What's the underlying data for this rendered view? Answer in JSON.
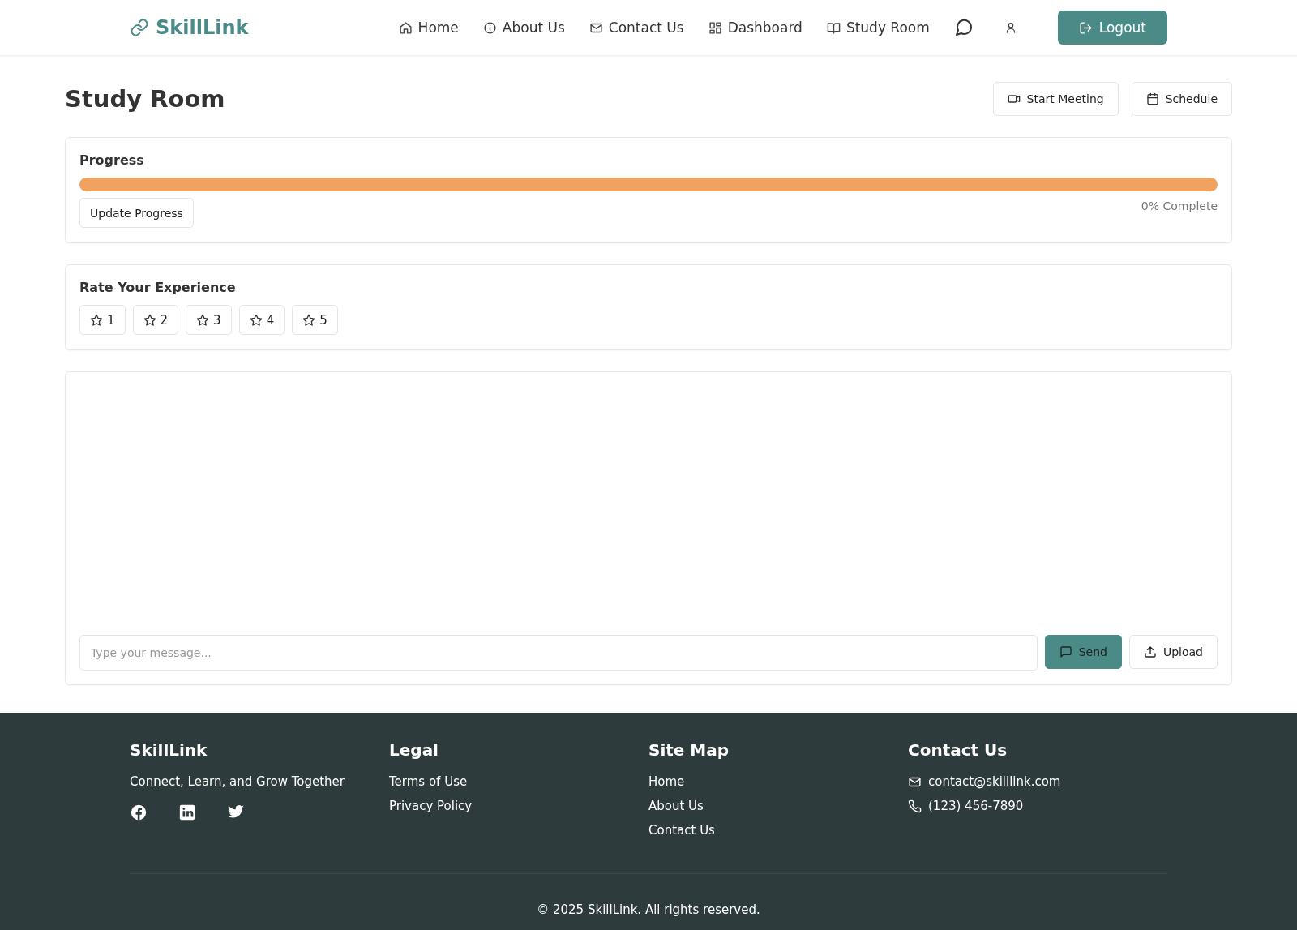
{
  "nav": {
    "brand": "SkillLink",
    "links": [
      {
        "label": "Home",
        "kind": "home"
      },
      {
        "label": "About Us",
        "kind": "info"
      },
      {
        "label": "Contact Us",
        "kind": "mail"
      },
      {
        "label": "Dashboard",
        "kind": "grid"
      },
      {
        "label": "Study Room",
        "kind": "book"
      }
    ],
    "logout": "Logout"
  },
  "page": {
    "title": "Study Room",
    "actions": [
      {
        "label": "Start Meeting",
        "kind": "video"
      },
      {
        "label": "Schedule",
        "kind": "calendar"
      }
    ]
  },
  "progress": {
    "title": "Progress",
    "level": 0,
    "reading": "0% Complete",
    "button": "Update Progress"
  },
  "rating": {
    "title": "Rate Your Experience",
    "options": [
      "1",
      "2",
      "3",
      "4",
      "5"
    ]
  },
  "chat": {
    "placeholder": "Type your message...",
    "send": "Send",
    "upload": "Upload"
  },
  "footer": {
    "brand": "SkillLink",
    "tagline": "Connect, Learn, and Grow Together",
    "columns": [
      {
        "title": "Legal",
        "links": [
          "Terms of Use",
          "Privacy Policy"
        ]
      },
      {
        "title": "Site Map",
        "links": [
          "Home",
          "About Us",
          "Contact Us"
        ]
      }
    ],
    "contact": {
      "title": "Contact Us",
      "email": "contact@skilllink.com",
      "phone": "(123) 456-7890"
    },
    "copyright": "© 2025 SkillLink. All rights reserved."
  }
}
